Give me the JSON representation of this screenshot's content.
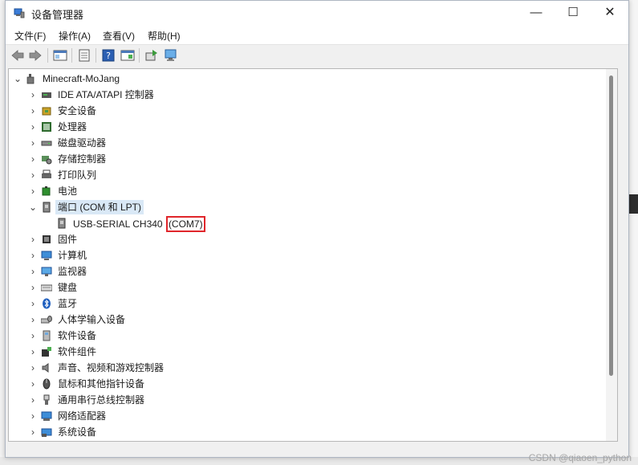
{
  "window": {
    "title": "设备管理器"
  },
  "menu": [
    "文件(F)",
    "操作(A)",
    "查看(V)",
    "帮助(H)"
  ],
  "toolbar": [
    "back-icon",
    "forward-icon",
    "properties-pane-icon",
    "device-list-icon",
    "help-icon",
    "view-icon",
    "update-driver-icon",
    "scan-hardware-icon"
  ],
  "tree": {
    "root": "Minecraft-MoJang",
    "categories": [
      {
        "label": "IDE ATA/ATAPI 控制器",
        "icon": "ide-icon"
      },
      {
        "label": "安全设备",
        "icon": "security-icon"
      },
      {
        "label": "处理器",
        "icon": "processor-icon"
      },
      {
        "label": "磁盘驱动器",
        "icon": "disk-icon"
      },
      {
        "label": "存储控制器",
        "icon": "storage-icon"
      },
      {
        "label": "打印队列",
        "icon": "printer-icon"
      },
      {
        "label": "电池",
        "icon": "battery-icon"
      },
      {
        "label": "端口 (COM 和 LPT)",
        "icon": "port-icon",
        "expanded": true
      },
      {
        "label": "固件",
        "icon": "firmware-icon"
      },
      {
        "label": "计算机",
        "icon": "computer-icon"
      },
      {
        "label": "监视器",
        "icon": "monitor-icon"
      },
      {
        "label": "键盘",
        "icon": "keyboard-icon"
      },
      {
        "label": "蓝牙",
        "icon": "bluetooth-icon"
      },
      {
        "label": "人体学输入设备",
        "icon": "hid-icon"
      },
      {
        "label": "软件设备",
        "icon": "software-device-icon"
      },
      {
        "label": "软件组件",
        "icon": "software-component-icon"
      },
      {
        "label": "声音、视频和游戏控制器",
        "icon": "audio-icon"
      },
      {
        "label": "鼠标和其他指针设备",
        "icon": "mouse-icon"
      },
      {
        "label": "通用串行总线控制器",
        "icon": "usb-icon"
      },
      {
        "label": "网络适配器",
        "icon": "network-icon"
      },
      {
        "label": "系统设备",
        "icon": "system-icon"
      }
    ],
    "port_child": {
      "name": "USB-SERIAL CH340 ",
      "com": "(COM7)"
    }
  },
  "watermark": "CSDN @qiaoen_python",
  "colors": {
    "highlight_box": "#e0262b",
    "selection": "#d9e8f6"
  }
}
